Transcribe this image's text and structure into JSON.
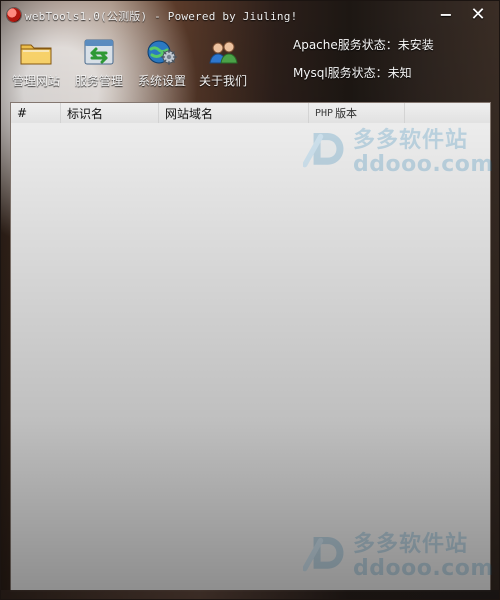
{
  "window": {
    "title": "webTools1.0(公测版) - Powered by Jiuling!",
    "min_glyph": "−",
    "close_glyph": "✕"
  },
  "toolbar": {
    "items": [
      {
        "label": "管理网站",
        "icon": "folder-icon"
      },
      {
        "label": "服务管理",
        "icon": "swap-arrows-icon"
      },
      {
        "label": "系统设置",
        "icon": "globe-gear-icon"
      },
      {
        "label": "关于我们",
        "icon": "users-icon"
      }
    ]
  },
  "status": {
    "apache": "Apache服务状态：未安装",
    "mysql": "Mysql服务状态：未知"
  },
  "table": {
    "headers": {
      "hash": "#",
      "id": "标识名",
      "domain": "网站域名",
      "php_prefix": "PHP",
      "php_suffix": "版本"
    }
  },
  "watermark": {
    "cn": "多多软件站",
    "en": "ddooo.com"
  },
  "colors": {
    "watermark": "#0f7fbf"
  }
}
